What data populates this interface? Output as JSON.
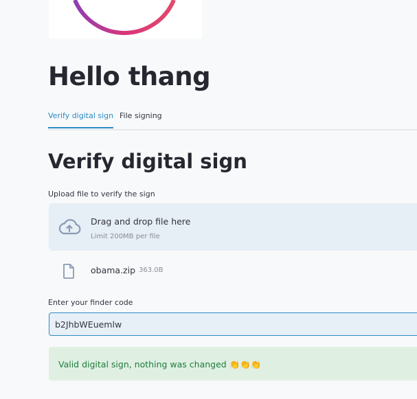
{
  "app": {
    "greeting": "Hello thang"
  },
  "tabs": [
    {
      "label": "Verify digital sign",
      "active": true
    },
    {
      "label": "File signing",
      "active": false
    }
  ],
  "section": {
    "title": "Verify digital sign"
  },
  "uploader": {
    "label": "Upload file to verify the sign",
    "drop_text": "Drag and drop file here",
    "limit_text": "Limit 200MB per file",
    "file": {
      "name": "obama.zip",
      "size": "363.0B"
    }
  },
  "finder": {
    "label": "Enter your finder code",
    "value": "b2JhbWEuemlw"
  },
  "result": {
    "message": "Valid digital sign, nothing was changed",
    "emojis": "👏👏👏"
  },
  "colors": {
    "accent": "#2b8bc6",
    "dropzone_bg": "#e6eef6",
    "success_bg": "#dff0e3",
    "success_text": "#1e7b3a"
  },
  "icons": {
    "upload": "cloud-upload-icon",
    "file": "file-icon"
  }
}
